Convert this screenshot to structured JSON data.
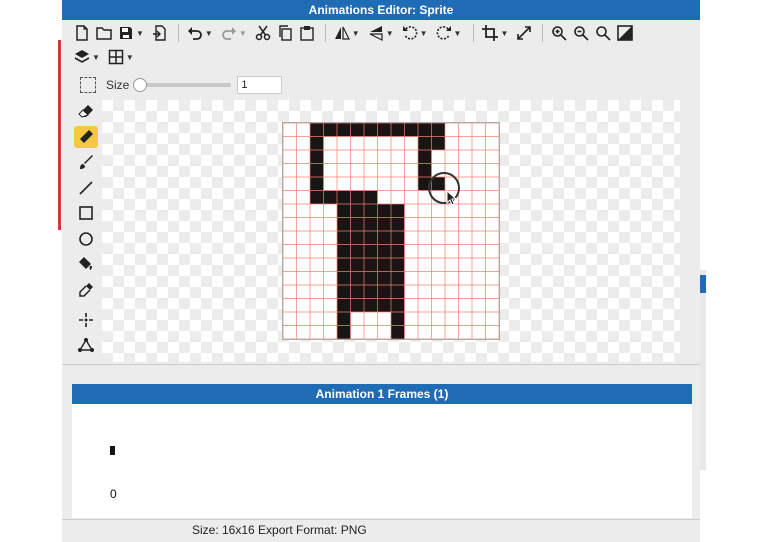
{
  "window": {
    "title": "Animations Editor: Sprite"
  },
  "toolbar": {
    "row1": [
      "new-file-icon",
      "open-folder-icon",
      "save-icon",
      "export-icon",
      "undo-icon",
      "redo-icon",
      "cut-icon",
      "copy-icon",
      "paste-icon",
      "flip-horizontal-icon",
      "flip-vertical-icon",
      "rotate-left-icon",
      "rotate-right-icon",
      "crop-icon",
      "resize-icon",
      "zoom-in-icon",
      "zoom-out-icon",
      "zoom-fit-icon",
      "toggle-background-icon"
    ],
    "row2": [
      "layers-icon",
      "grid-icon"
    ]
  },
  "size_control": {
    "label": "Size",
    "value": "1"
  },
  "tools": [
    "eraser-icon",
    "pencil-icon",
    "brush-icon",
    "line-icon",
    "rectangle-icon",
    "ellipse-icon",
    "fill-bucket-icon",
    "eyedropper-icon",
    "magic-wand-icon",
    "shape-tool-icon"
  ],
  "active_tool": "pencil-icon",
  "canvas": {
    "grid_size": 16,
    "pixel_color": "#1a1414",
    "grid_color": "#f08070",
    "rows": [
      "  ##########    ",
      "  #       ##    ",
      "  #       #     ",
      "  #       #     ",
      "  #       ##    ",
      "  #####       ",
      "    #####       ",
      "    #####       ",
      "    #####       ",
      "    #####       ",
      "    #####       ",
      "    #####       ",
      "    #####       ",
      "    #####       ",
      "    #   #       ",
      "    #   #       "
    ]
  },
  "frames_panel": {
    "title": "Animation 1 Frames (1)",
    "frames": [
      {
        "index": "0"
      }
    ]
  },
  "status": {
    "text": "Size: 16x16   Export Format: PNG"
  },
  "colors": {
    "accent": "#1f6cb5",
    "active_tool": "#f5c842",
    "panel_bg": "#ececec"
  }
}
